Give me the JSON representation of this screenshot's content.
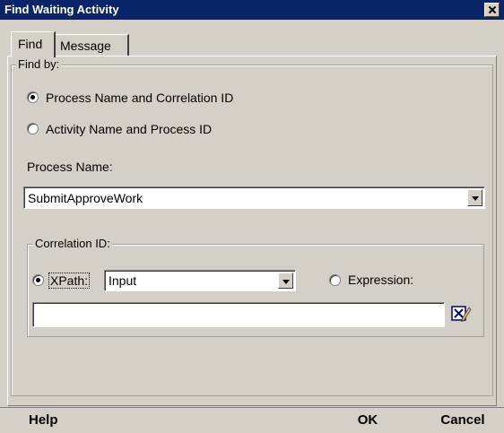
{
  "window": {
    "title": "Find Waiting Activity"
  },
  "tabs": [
    {
      "label": "Find"
    },
    {
      "label": "Message"
    }
  ],
  "find_by": {
    "legend": "Find by:",
    "options": [
      {
        "label": "Process Name and Correlation ID",
        "selected": true
      },
      {
        "label": "Activity Name and Process ID",
        "selected": false
      }
    ]
  },
  "process_name": {
    "label": "Process Name:",
    "value": "SubmitApproveWork"
  },
  "correlation": {
    "legend": "Correlation ID:",
    "xpath_label": "XPath:",
    "xpath_selected": true,
    "xpath_value": "Input",
    "expression_label": "Expression:",
    "expression_selected": false,
    "expression_value": ""
  },
  "buttons": {
    "help": "Help",
    "ok": "OK",
    "cancel": "Cancel"
  },
  "icons": {
    "close": "close-icon",
    "edit_expression": "xpath-editor-icon"
  }
}
